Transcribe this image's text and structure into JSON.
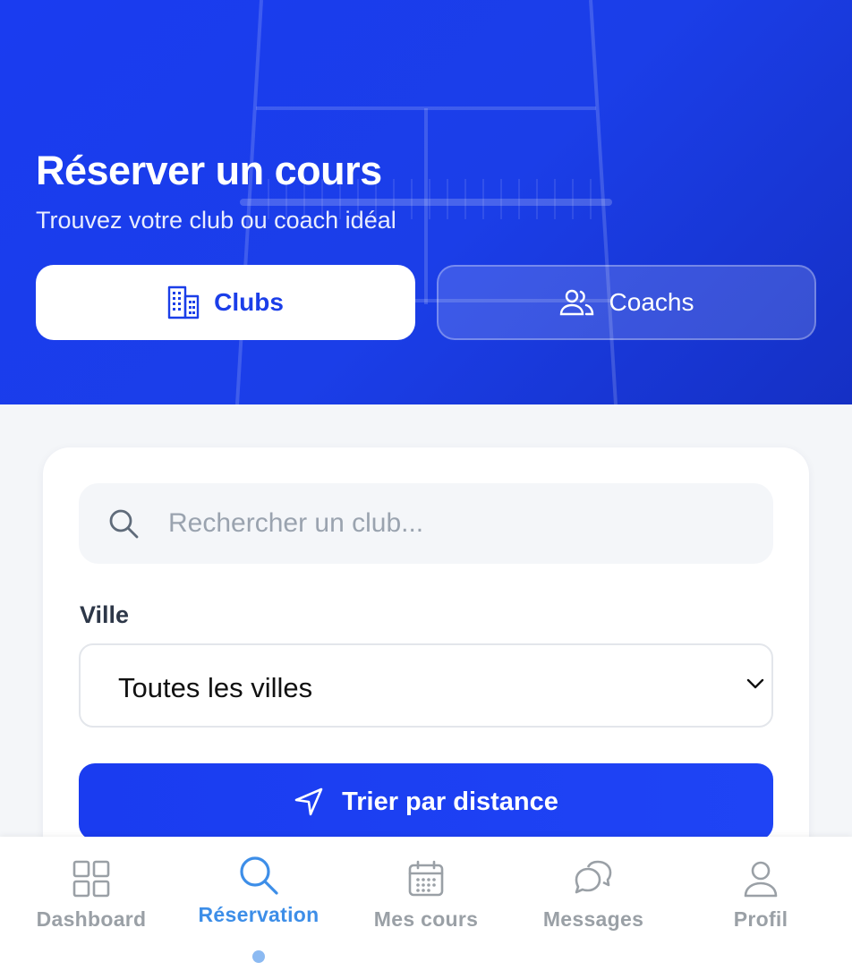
{
  "hero": {
    "title": "Réserver un cours",
    "subtitle": "Trouvez votre club ou coach idéal"
  },
  "segments": [
    {
      "label": "Clubs",
      "icon": "building-icon",
      "active": true
    },
    {
      "label": "Coachs",
      "icon": "users-icon",
      "active": false
    }
  ],
  "search": {
    "placeholder": "Rechercher un club...",
    "value": ""
  },
  "filters": {
    "city_label": "Ville",
    "city_value": "Toutes les villes"
  },
  "sort_button": {
    "label": "Trier par distance",
    "icon": "navigation-arrow-icon"
  },
  "tabbar": {
    "items": [
      {
        "label": "Dashboard",
        "icon": "grid-icon",
        "active": false
      },
      {
        "label": "Réservation",
        "icon": "search-icon",
        "active": true
      },
      {
        "label": "Mes cours",
        "icon": "calendar-icon",
        "active": false
      },
      {
        "label": "Messages",
        "icon": "chat-icon",
        "active": false
      },
      {
        "label": "Profil",
        "icon": "user-icon",
        "active": false
      }
    ]
  },
  "colors": {
    "primary": "#1b3ee8",
    "active_tab": "#3d8ee8",
    "inactive_tab": "#9aa0a6",
    "background": "#f4f6f9"
  }
}
